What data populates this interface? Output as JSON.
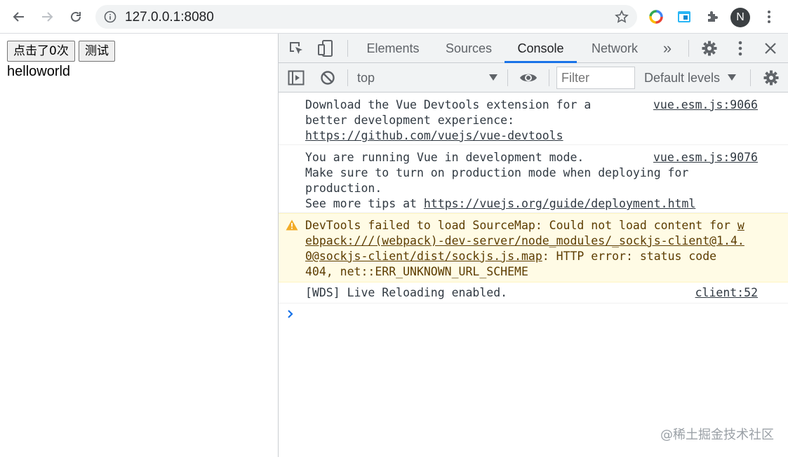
{
  "browser": {
    "url": "127.0.0.1:8080",
    "avatar_letter": "N",
    "icons": [
      "back-arrow-icon",
      "forward-arrow-icon",
      "reload-icon",
      "info-icon",
      "star-icon",
      "extension-circle-icon",
      "extension-window-icon",
      "puzzle-icon",
      "kebab-menu-icon"
    ]
  },
  "page": {
    "button_click": "点击了0次",
    "button_test": "测试",
    "text": "helloworld"
  },
  "devtools": {
    "tabs": [
      {
        "label": "Elements"
      },
      {
        "label": "Sources"
      },
      {
        "label": "Console"
      },
      {
        "label": "Network"
      }
    ],
    "more_tabs": "»",
    "active_tab": "Console",
    "accent_color": "#1a73e8",
    "toolbar": {
      "context": "top",
      "filter_placeholder": "Filter",
      "levels": "Default levels"
    },
    "messages": [
      {
        "type": "log",
        "lines": [
          "Download the Vue Devtools extension for a",
          "better development experience:"
        ],
        "link": "https://github.com/vuejs/vue-devtools",
        "source": "vue.esm.js:9066"
      },
      {
        "type": "log",
        "lines": [
          "You are running Vue in development mode.",
          "Make sure to turn on production mode when deploying for",
          "production."
        ],
        "tip_prefix": "See more tips at ",
        "link": "https://vuejs.org/guide/deployment.html",
        "source": "vue.esm.js:9076"
      },
      {
        "type": "warning",
        "prefix": "DevTools failed to load SourceMap: Could not load content for ",
        "link_part1": "w",
        "link_part2": "ebpack:///(webpack)-dev-server/node_modules/_sockjs-client@1.4.",
        "link_part3": "0@sockjs-client/dist/sockjs.js.map",
        "suffix": ": HTTP error: status code",
        "line4": "404, net::ERR_UNKNOWN_URL_SCHEME",
        "color": "#5c3c00",
        "background": "#fffbe5"
      },
      {
        "type": "log",
        "text": "[WDS] Live Reloading enabled.",
        "source": "client:52"
      }
    ],
    "prompt_symbol": "›"
  },
  "watermark": "@稀土掘金技术社区"
}
